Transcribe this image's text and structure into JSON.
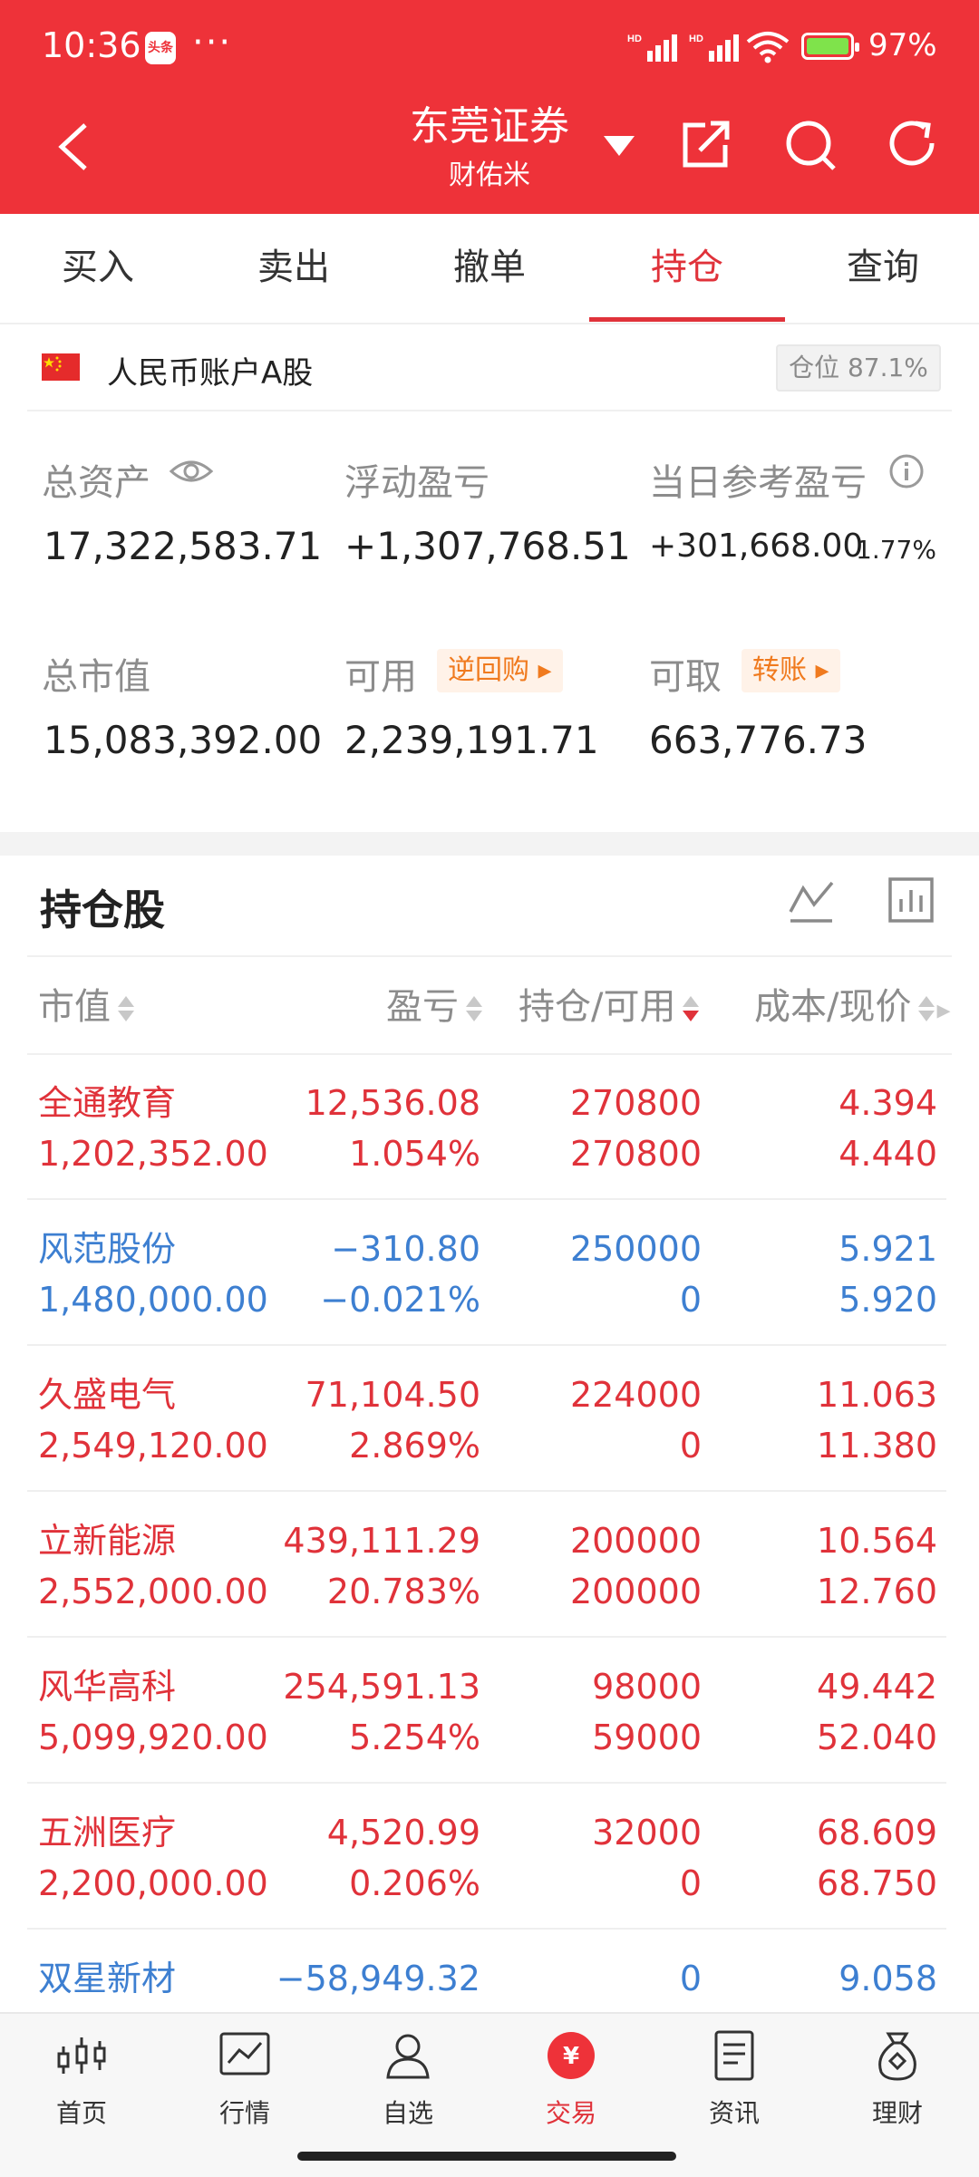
{
  "status_bar": {
    "time": "10:36",
    "news_badge": "头条",
    "dots": "···",
    "hd1": "HD",
    "hd2": "HD",
    "battery": "97%"
  },
  "header": {
    "title": "东莞证券",
    "subtitle": "财佑米"
  },
  "tabs": [
    {
      "label": "买入"
    },
    {
      "label": "卖出"
    },
    {
      "label": "撤单"
    },
    {
      "label": "持仓",
      "active": true
    },
    {
      "label": "查询"
    }
  ],
  "account": {
    "label": "人民币账户A股",
    "position": "仓位 87.1%",
    "total_assets_label": "总资产",
    "total_assets": "17,322,583.71",
    "floating_pl_label": "浮动盈亏",
    "floating_pl": "+1,307,768.51",
    "daily_pl_label": "当日参考盈亏",
    "daily_pl": "+301,668.00",
    "daily_pl_pct": "1.77%",
    "market_value_label": "总市值",
    "market_value": "15,083,392.00",
    "available_label": "可用",
    "available": "2,239,191.71",
    "reverse_repo_tag": "逆回购",
    "withdrawable_label": "可取",
    "withdrawable": "663,776.73",
    "transfer_tag": "转账"
  },
  "holdings": {
    "title": "持仓股",
    "columns": [
      "市值",
      "盈亏",
      "持仓/可用",
      "成本/现价"
    ],
    "rows": [
      {
        "name": "全通教育",
        "market_value": "1,202,352.00",
        "pl": "12,536.08",
        "pl_pct": "1.054%",
        "holding": "270800",
        "available": "270800",
        "cost": "4.394",
        "price": "4.440",
        "color": "red"
      },
      {
        "name": "风范股份",
        "market_value": "1,480,000.00",
        "pl": "−310.80",
        "pl_pct": "−0.021%",
        "holding": "250000",
        "available": "0",
        "cost": "5.921",
        "price": "5.920",
        "color": "blue"
      },
      {
        "name": "久盛电气",
        "market_value": "2,549,120.00",
        "pl": "71,104.50",
        "pl_pct": "2.869%",
        "holding": "224000",
        "available": "0",
        "cost": "11.063",
        "price": "11.380",
        "color": "red"
      },
      {
        "name": "立新能源",
        "market_value": "2,552,000.00",
        "pl": "439,111.29",
        "pl_pct": "20.783%",
        "holding": "200000",
        "available": "200000",
        "cost": "10.564",
        "price": "12.760",
        "color": "red"
      },
      {
        "name": "风华高科",
        "market_value": "5,099,920.00",
        "pl": "254,591.13",
        "pl_pct": "5.254%",
        "holding": "98000",
        "available": "59000",
        "cost": "49.442",
        "price": "52.040",
        "color": "red"
      },
      {
        "name": "五洲医疗",
        "market_value": "2,200,000.00",
        "pl": "4,520.99",
        "pl_pct": "0.206%",
        "holding": "32000",
        "available": "0",
        "cost": "68.609",
        "price": "68.750",
        "color": "red"
      },
      {
        "name": "双星新材",
        "market_value": "",
        "pl": "−58,949.32",
        "pl_pct": "",
        "holding": "0",
        "available": "",
        "cost": "9.058",
        "price": "",
        "color": "blue"
      }
    ]
  },
  "nav": [
    {
      "label": "首页",
      "icon": "candlestick-icon"
    },
    {
      "label": "行情",
      "icon": "chart-icon"
    },
    {
      "label": "自选",
      "icon": "user-icon"
    },
    {
      "label": "交易",
      "icon": "yuan-icon",
      "active": true
    },
    {
      "label": "资讯",
      "icon": "document-icon"
    },
    {
      "label": "理财",
      "icon": "moneybag-icon"
    }
  ],
  "colors": {
    "brand_red": "#ee3239",
    "up": "#e0323a",
    "down": "#3d7fd1"
  }
}
